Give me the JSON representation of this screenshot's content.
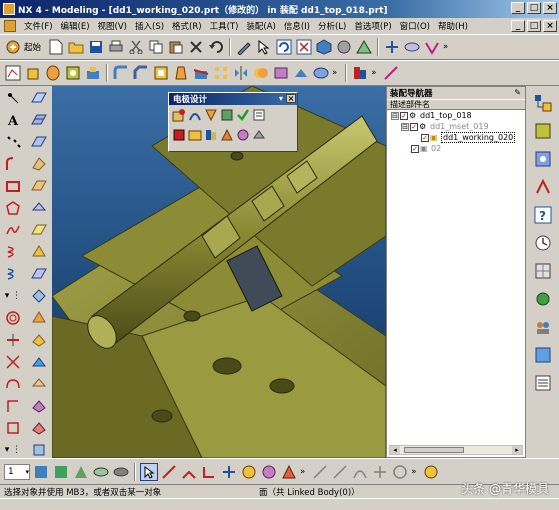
{
  "window": {
    "title": "NX 4 - Modeling - [dd1_working_020.prt（修改的） in 装配 dd1_top_018.prt]",
    "min": "_",
    "max": "□",
    "close": "×"
  },
  "menu": {
    "items": [
      "文件(F)",
      "编辑(E)",
      "视图(V)",
      "插入(S)",
      "格式(R)",
      "工具(T)",
      "装配(A)",
      "信息(I)",
      "分析(L)",
      "首选项(P)",
      "窗口(O)",
      "帮助(H)"
    ]
  },
  "toolbar1": {
    "start_label": "起始",
    "chevron": "»"
  },
  "palette": {
    "title": "电极设计",
    "dropdown": "▾",
    "close": "×"
  },
  "navigator": {
    "title": "装配导航器",
    "column_header": "描述部件名",
    "tree": [
      {
        "label": "dd1_top_018",
        "level": 0,
        "expander": "⊟"
      },
      {
        "label": "dd1_mset_019",
        "level": 1,
        "expander": "⊟"
      },
      {
        "label": "dd1_working_020",
        "level": 2,
        "expander": ""
      },
      {
        "label": "02",
        "level": 1,
        "expander": ""
      }
    ]
  },
  "bottom": {
    "number": "1"
  },
  "status": {
    "prompt": "选择对象并使用 MB3，或者双击某一对象",
    "selection": "面（共 Linked Body(0)）"
  },
  "watermark": "头条 @青华模具",
  "colors": {
    "titlebar": "#0a246a",
    "model": "#8a8a2a",
    "viewport_bg": "#0c3e7a"
  }
}
